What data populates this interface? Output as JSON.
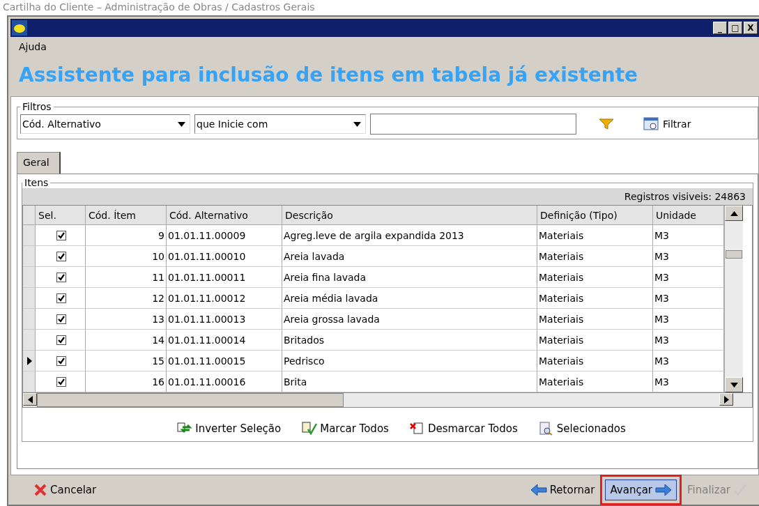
{
  "caption": "Cartilha do Cliente – Administração de Obras / Cadastros Gerais",
  "window": {
    "title_controls": [
      "_",
      "□",
      "X"
    ]
  },
  "menu": [
    {
      "label": "Ajuda"
    }
  ],
  "heading": "Assistente para inclusão de itens em tabela já existente",
  "filters": {
    "legend": "Filtros",
    "field": "Cód. Alternativo",
    "operator": "que Inicie com",
    "filter_button": "Filtrar"
  },
  "tabs": [
    {
      "label": "Geral",
      "selected": true
    }
  ],
  "items": {
    "legend": "Itens",
    "count": "Registros visiveis: 24863",
    "columns": [
      "Sel.",
      "Cód. Ítem",
      "Cód. Alternativo",
      "Descrição",
      "Definição (Tipo)",
      "Unidade"
    ],
    "rows": [
      {
        "checked": true,
        "current": false,
        "code": "9",
        "alt": "01.01.11.00009",
        "desc": "Agreg.leve de argila expandida 2013",
        "type": "Materiais",
        "unit": "M3"
      },
      {
        "checked": true,
        "current": false,
        "code": "10",
        "alt": "01.01.11.00010",
        "desc": "Areia lavada",
        "type": "Materiais",
        "unit": "M3"
      },
      {
        "checked": true,
        "current": false,
        "code": "11",
        "alt": "01.01.11.00011",
        "desc": "Areia fina lavada",
        "type": "Materiais",
        "unit": "M3"
      },
      {
        "checked": true,
        "current": false,
        "code": "12",
        "alt": "01.01.11.00012",
        "desc": "Areia média lavada",
        "type": "Materiais",
        "unit": "M3"
      },
      {
        "checked": true,
        "current": false,
        "code": "13",
        "alt": "01.01.11.00013",
        "desc": "Areia grossa lavada",
        "type": "Materiais",
        "unit": "M3"
      },
      {
        "checked": true,
        "current": false,
        "code": "14",
        "alt": "01.01.11.00014",
        "desc": "Britados",
        "type": "Materiais",
        "unit": "M3"
      },
      {
        "checked": true,
        "current": true,
        "code": "15",
        "alt": "01.01.11.00015",
        "desc": "Pedrisco",
        "type": "Materiais",
        "unit": "M3"
      },
      {
        "checked": true,
        "current": false,
        "code": "16",
        "alt": "01.01.11.00016",
        "desc": "Brita",
        "type": "Materiais",
        "unit": "M3"
      }
    ],
    "actions": [
      {
        "kind": "invert",
        "label": "Inverter Seleção"
      },
      {
        "kind": "mark",
        "label": "Marcar Todos"
      },
      {
        "kind": "unmark",
        "label": "Desmarcar Todos"
      },
      {
        "kind": "selected",
        "label": "Selecionados"
      }
    ]
  },
  "footer": [
    {
      "kind": "cancel",
      "label": "Cancelar",
      "disabled": false,
      "highlighted": false
    },
    {
      "kind": "back",
      "label": "Retornar",
      "disabled": false,
      "highlighted": false
    },
    {
      "kind": "next",
      "label": "Avançar",
      "disabled": false,
      "highlighted": true
    },
    {
      "kind": "finish",
      "label": "Finalizar",
      "disabled": true,
      "highlighted": false
    }
  ]
}
